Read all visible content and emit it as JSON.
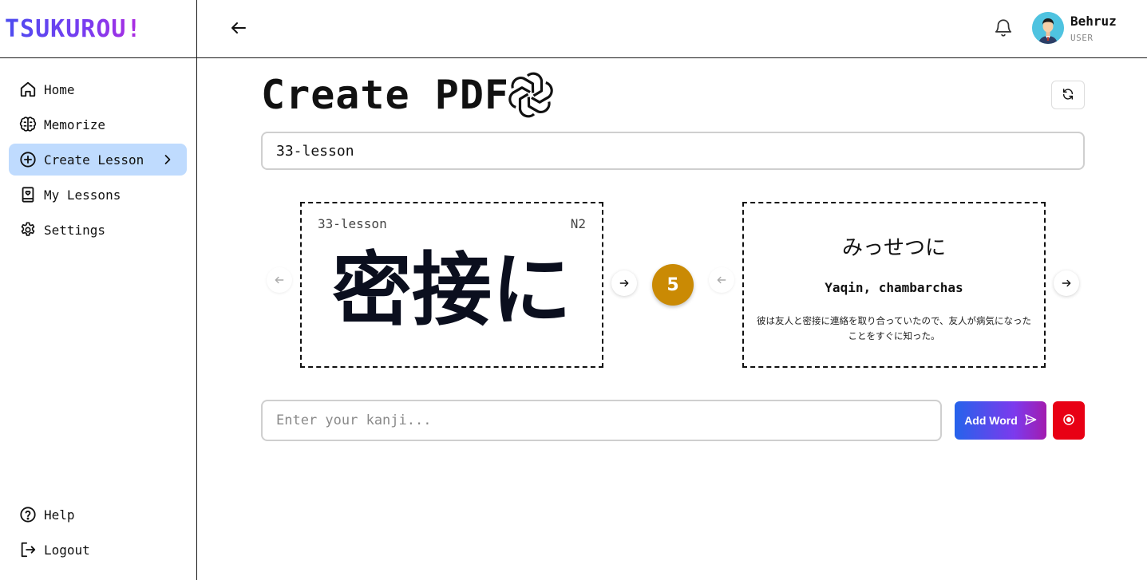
{
  "app": {
    "logo": "TSUKUROU!"
  },
  "sidebar": {
    "items": [
      {
        "label": "Home",
        "icon": "home-icon"
      },
      {
        "label": "Memorize",
        "icon": "brain-icon"
      },
      {
        "label": "Create Lesson",
        "icon": "plus-circle-icon",
        "active": true
      },
      {
        "label": "My Lessons",
        "icon": "notebook-icon"
      },
      {
        "label": "Settings",
        "icon": "gear-icon"
      }
    ],
    "bottom_items": [
      {
        "label": "Help",
        "icon": "help-circle-icon"
      },
      {
        "label": "Logout",
        "icon": "logout-icon"
      }
    ]
  },
  "header": {
    "user_name": "Behruz",
    "user_role": "USER"
  },
  "main": {
    "title": "Create PDF",
    "lesson_name_value": "33-lesson",
    "card_front": {
      "lesson": "33-lesson",
      "level": "N2",
      "kanji": "密接に"
    },
    "card_back": {
      "reading": "みっせつに",
      "meaning": "Yaqin, chambarchas",
      "example": "彼は友人と密接に連絡を取り合っていたので、友人が病気になったことをすぐに知った。"
    },
    "word_count": "5",
    "kanji_input_placeholder": "Enter your kanji...",
    "add_button_label": "Add Word"
  },
  "colors": {
    "active_nav": "#bfdbfe",
    "badge": "#ca8a04",
    "record_button": "#e80014",
    "add_button_gradient": [
      "#2563eb",
      "#7c3aed",
      "#a21caf"
    ]
  }
}
